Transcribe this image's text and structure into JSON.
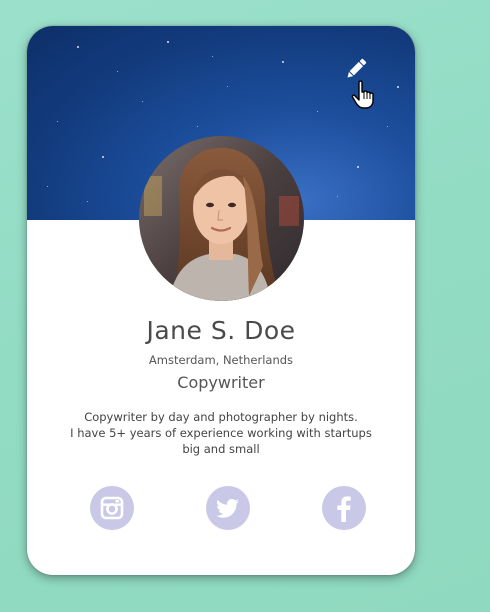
{
  "profile": {
    "name": "Jane S. Doe",
    "location": "Amsterdam, Netherlands",
    "title": "Copywriter",
    "bio": [
      "Copywriter by day and photographer by nights.",
      "I have 5+ years of experience working with startups",
      "big and small"
    ]
  },
  "header": {
    "edit_icon": "pencil-icon",
    "cursor_icon": "hand-pointer-icon"
  },
  "social": [
    {
      "network": "Instagram",
      "icon": "instagram-icon"
    },
    {
      "network": "Twitter",
      "icon": "twitter-icon"
    },
    {
      "network": "Facebook",
      "icon": "facebook-icon"
    }
  ],
  "colors": {
    "background": "#93dcc4",
    "card": "#ffffff",
    "banner": "#1d4f9e",
    "social_icon": "#c9c8e7",
    "text": "#4a4a4a"
  }
}
